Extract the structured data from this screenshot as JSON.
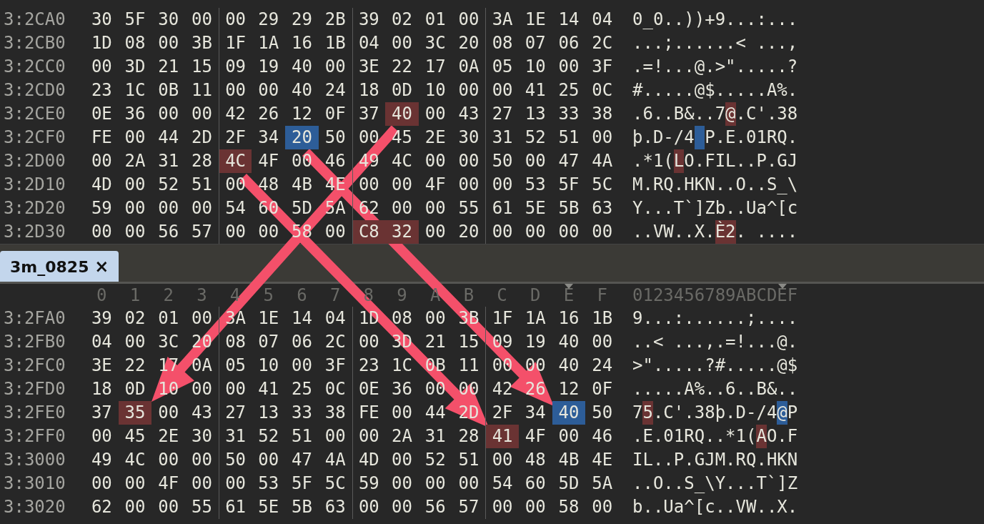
{
  "top_pane": {
    "rows": [
      {
        "address": "3:2CA0",
        "bytes": [
          "30",
          "5F",
          "30",
          "00",
          "00",
          "29",
          "29",
          "2B",
          "39",
          "02",
          "01",
          "00",
          "3A",
          "1E",
          "14",
          "04"
        ],
        "ascii": "0_0..))+9...:..."
      },
      {
        "address": "3:2CB0",
        "bytes": [
          "1D",
          "08",
          "00",
          "3B",
          "1F",
          "1A",
          "16",
          "1B",
          "04",
          "00",
          "3C",
          "20",
          "08",
          "07",
          "06",
          "2C"
        ],
        "ascii": "...;......< ...,"
      },
      {
        "address": "3:2CC0",
        "bytes": [
          "00",
          "3D",
          "21",
          "15",
          "09",
          "19",
          "40",
          "00",
          "3E",
          "22",
          "17",
          "0A",
          "05",
          "10",
          "00",
          "3F"
        ],
        "ascii": ".=!...@.>\".....?"
      },
      {
        "address": "3:2CD0",
        "bytes": [
          "23",
          "1C",
          "0B",
          "11",
          "00",
          "00",
          "40",
          "24",
          "18",
          "0D",
          "10",
          "00",
          "00",
          "41",
          "25",
          "0C"
        ],
        "ascii": "#.....@$.....A%."
      },
      {
        "address": "3:2CE0",
        "bytes": [
          "0E",
          "36",
          "00",
          "00",
          "42",
          "26",
          "12",
          "0F",
          "37",
          "40",
          "00",
          "43",
          "27",
          "13",
          "33",
          "38"
        ],
        "ascii": ".6..B&..7@.C'.38",
        "modified": [
          false,
          false,
          false,
          false,
          false,
          false,
          false,
          false,
          false,
          true,
          false,
          false,
          false,
          false,
          false,
          false
        ]
      },
      {
        "address": "3:2CF0",
        "bytes": [
          "FE",
          "00",
          "44",
          "2D",
          "2F",
          "34",
          "20",
          "50",
          "00",
          "45",
          "2E",
          "30",
          "31",
          "52",
          "51",
          "00"
        ],
        "ascii": "þ.D-/4 P.E.01RQ.",
        "cursor": [
          false,
          false,
          false,
          false,
          false,
          false,
          true,
          false,
          false,
          false,
          false,
          false,
          false,
          false,
          false,
          false
        ]
      },
      {
        "address": "3:2D00",
        "bytes": [
          "00",
          "2A",
          "31",
          "28",
          "4C",
          "4F",
          "00",
          "46",
          "49",
          "4C",
          "00",
          "00",
          "50",
          "00",
          "47",
          "4A"
        ],
        "ascii": ".*1(LO.FIL..P.GJ",
        "modified": [
          false,
          false,
          false,
          false,
          true,
          false,
          false,
          false,
          false,
          false,
          false,
          false,
          false,
          false,
          false,
          false
        ]
      },
      {
        "address": "3:2D10",
        "bytes": [
          "4D",
          "00",
          "52",
          "51",
          "00",
          "48",
          "4B",
          "4E",
          "00",
          "00",
          "4F",
          "00",
          "00",
          "53",
          "5F",
          "5C"
        ],
        "ascii": "M.RQ.HKN..O..S_\\"
      },
      {
        "address": "3:2D20",
        "bytes": [
          "59",
          "00",
          "00",
          "00",
          "54",
          "60",
          "5D",
          "5A",
          "62",
          "00",
          "00",
          "55",
          "61",
          "5E",
          "5B",
          "63"
        ],
        "ascii": "Y...T`]Zb..Ua^[c"
      },
      {
        "address": "3:2D30",
        "bytes": [
          "00",
          "00",
          "56",
          "57",
          "00",
          "00",
          "58",
          "00",
          "C8",
          "32",
          "00",
          "20",
          "00",
          "00",
          "00",
          "00"
        ],
        "ascii": "..VW..X.È2. ....",
        "modified": [
          false,
          false,
          false,
          false,
          false,
          false,
          false,
          false,
          true,
          true,
          false,
          false,
          false,
          false,
          false,
          false
        ]
      }
    ]
  },
  "tabs": [
    {
      "label": "3m_0825",
      "close": "×",
      "selected": true
    }
  ],
  "bottom_pane": {
    "header": {
      "columns": [
        {
          "label": "0",
          "marked": false
        },
        {
          "label": "1",
          "marked": false
        },
        {
          "label": "2",
          "marked": false
        },
        {
          "label": "3",
          "marked": false
        },
        {
          "label": "4",
          "marked": false
        },
        {
          "label": "5",
          "marked": false
        },
        {
          "label": "6",
          "marked": false
        },
        {
          "label": "7",
          "marked": false
        },
        {
          "label": "8",
          "marked": false
        },
        {
          "label": "9",
          "marked": false
        },
        {
          "label": "A",
          "marked": false
        },
        {
          "label": "B",
          "marked": false
        },
        {
          "label": "C",
          "marked": false
        },
        {
          "label": "D",
          "marked": false
        },
        {
          "label": "E",
          "marked": true
        },
        {
          "label": "F",
          "marked": false
        }
      ],
      "ascii": "0123456789ABCDEF"
    },
    "rows": [
      {
        "address": "3:2FA0",
        "bytes": [
          "39",
          "02",
          "01",
          "00",
          "3A",
          "1E",
          "14",
          "04",
          "1D",
          "08",
          "00",
          "3B",
          "1F",
          "1A",
          "16",
          "1B"
        ],
        "ascii": "9...:......;...."
      },
      {
        "address": "3:2FB0",
        "bytes": [
          "04",
          "00",
          "3C",
          "20",
          "08",
          "07",
          "06",
          "2C",
          "00",
          "3D",
          "21",
          "15",
          "09",
          "19",
          "40",
          "00"
        ],
        "ascii": "..< ...,.=!...@."
      },
      {
        "address": "3:2FC0",
        "bytes": [
          "3E",
          "22",
          "17",
          "0A",
          "05",
          "10",
          "00",
          "3F",
          "23",
          "1C",
          "0B",
          "11",
          "00",
          "00",
          "40",
          "24"
        ],
        "ascii": ">\".....?#.....@$"
      },
      {
        "address": "3:2FD0",
        "bytes": [
          "18",
          "0D",
          "10",
          "00",
          "00",
          "41",
          "25",
          "0C",
          "0E",
          "36",
          "00",
          "00",
          "42",
          "26",
          "12",
          "0F"
        ],
        "ascii": ".....A%..6..B&.."
      },
      {
        "address": "3:2FE0",
        "bytes": [
          "37",
          "35",
          "00",
          "43",
          "27",
          "13",
          "33",
          "38",
          "FE",
          "00",
          "44",
          "2D",
          "2F",
          "34",
          "40",
          "50"
        ],
        "ascii": "75.C'.38þ.D-/4@P",
        "modified": [
          false,
          true,
          false,
          false,
          false,
          false,
          false,
          false,
          false,
          false,
          false,
          false,
          false,
          false,
          false,
          false
        ],
        "cursor": [
          false,
          false,
          false,
          false,
          false,
          false,
          false,
          false,
          false,
          false,
          false,
          false,
          false,
          false,
          true,
          false
        ]
      },
      {
        "address": "3:2FF0",
        "bytes": [
          "00",
          "45",
          "2E",
          "30",
          "31",
          "52",
          "51",
          "00",
          "00",
          "2A",
          "31",
          "28",
          "41",
          "4F",
          "00",
          "46"
        ],
        "ascii": ".E.01RQ..*1(AO.F",
        "modified": [
          false,
          false,
          false,
          false,
          false,
          false,
          false,
          false,
          false,
          false,
          false,
          false,
          true,
          false,
          false,
          false
        ]
      },
      {
        "address": "3:3000",
        "bytes": [
          "49",
          "4C",
          "00",
          "00",
          "50",
          "00",
          "47",
          "4A",
          "4D",
          "00",
          "52",
          "51",
          "00",
          "48",
          "4B",
          "4E"
        ],
        "ascii": "IL..P.GJM.RQ.HKN"
      },
      {
        "address": "3:3010",
        "bytes": [
          "00",
          "00",
          "4F",
          "00",
          "00",
          "53",
          "5F",
          "5C",
          "59",
          "00",
          "00",
          "00",
          "54",
          "60",
          "5D",
          "5A"
        ],
        "ascii": "..O..S_\\Y...T`]Z"
      },
      {
        "address": "3:3020",
        "bytes": [
          "62",
          "00",
          "00",
          "55",
          "61",
          "5E",
          "5B",
          "63",
          "00",
          "00",
          "56",
          "57",
          "00",
          "00",
          "58",
          "00"
        ],
        "ascii": "b..Ua^[c..VW..X."
      }
    ]
  }
}
